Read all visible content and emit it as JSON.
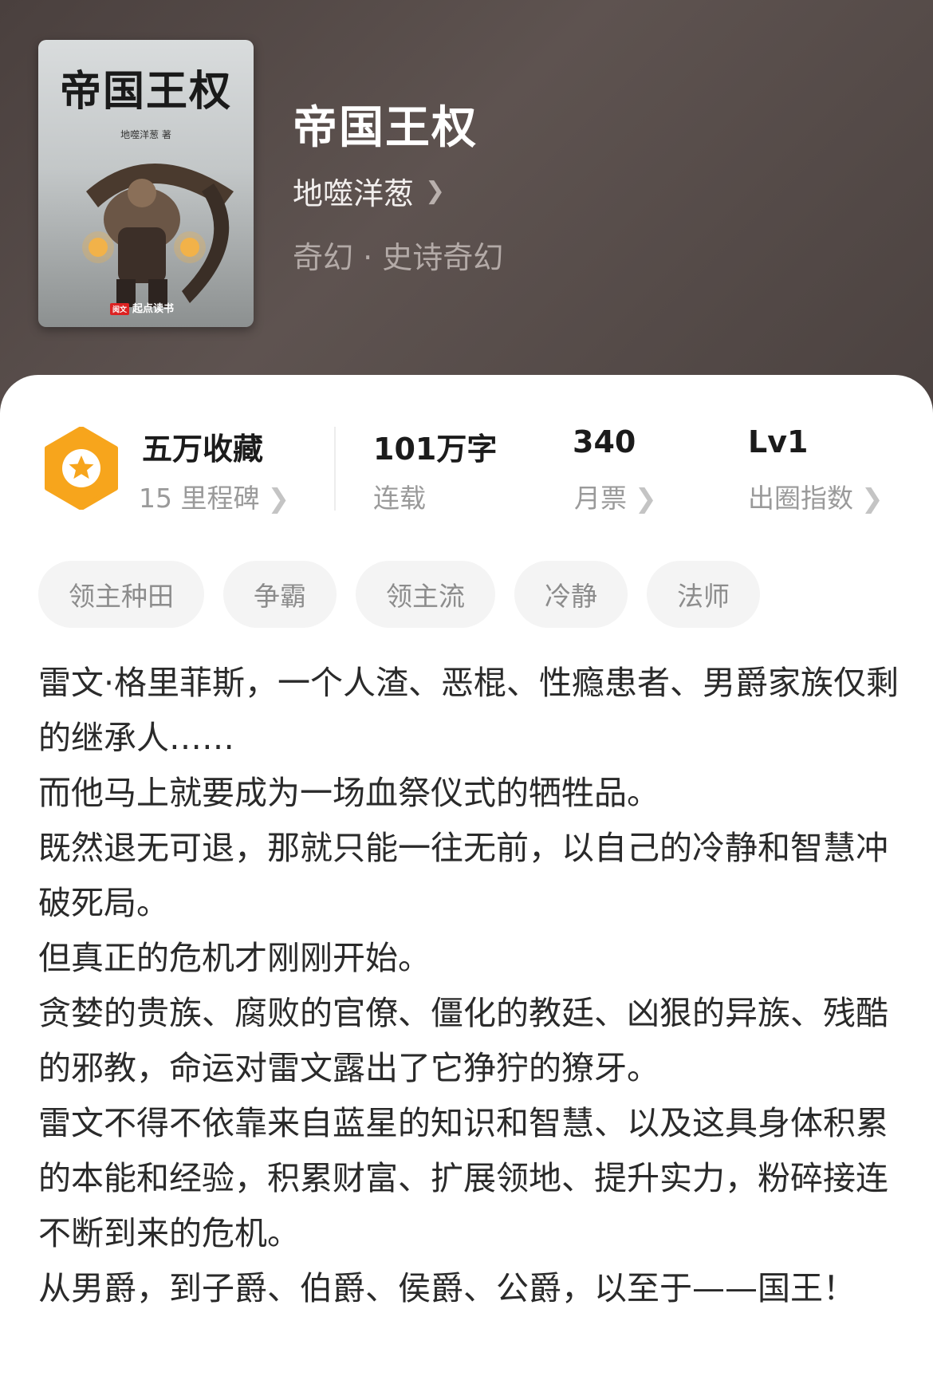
{
  "cover": {
    "title": "帝国王权",
    "author_caption": "地噬洋葱 著",
    "brand_badge": "阅文",
    "brand": "起点读书"
  },
  "book": {
    "title": "帝国王权",
    "author": "地噬洋葱",
    "genre": "奇幻 · 史诗奇幻"
  },
  "stats": {
    "collect_main": "五万收藏",
    "collect_sub": "15 里程碑",
    "words_main": "101万字",
    "words_sub": "连载",
    "tickets_main": "340",
    "tickets_sub": "月票",
    "level_main": "Lv1",
    "level_sub": "出圈指数"
  },
  "tags": [
    "领主种田",
    "争霸",
    "领主流",
    "冷静",
    "法师"
  ],
  "description": [
    "雷文·格里菲斯，一个人渣、恶棍、性瘾患者、男爵家族仅剩的继承人……",
    "而他马上就要成为一场血祭仪式的牺牲品。",
    "既然退无可退，那就只能一往无前，以自己的冷静和智慧冲破死局。",
    "但真正的危机才刚刚开始。",
    "贪婪的贵族、腐败的官僚、僵化的教廷、凶狠的异族、残酷的邪教，命运对雷文露出了它狰狞的獠牙。",
    "雷文不得不依靠来自蓝星的知识和智慧、以及这具身体积累的本能和经验，积累财富、扩展领地、提升实力，粉碎接连不断到来的危机。",
    "从男爵，到子爵、伯爵、侯爵、公爵，以至于——国王！"
  ],
  "colors": {
    "header_bg": "#554a48",
    "accent_orange": "#f7a51c"
  }
}
